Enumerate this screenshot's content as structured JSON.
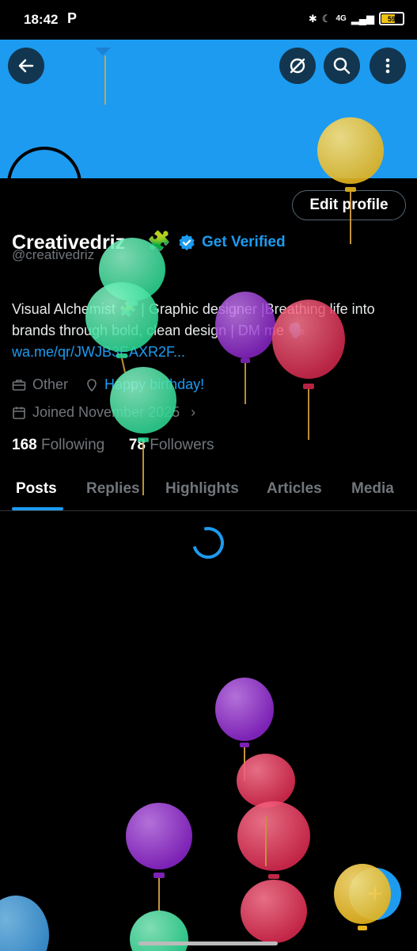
{
  "status_bar": {
    "time": "18:42",
    "app_letter": "P",
    "network": "4G",
    "battery_level": "59"
  },
  "header": {
    "back_icon": "arrow-left-icon",
    "hide_icon": "eye-slash-icon",
    "search_icon": "search-icon",
    "more_icon": "more-vertical-icon"
  },
  "profile": {
    "edit_label": "Edit profile",
    "name": "Creativedriz",
    "name_emoji": "🧩",
    "verified_label": "Get Verified",
    "handle": "@creativedriz",
    "bio": "Visual Alchemist 🧩 | Graphic designer |Breathing life into brands through bold, clean design | DM me 🗣️",
    "bio_link": "wa.me/qr/JWJB3EAXR2F...",
    "category": "Other",
    "location_text": "Happy birthday!",
    "joined": "Joined November 2025",
    "following_count": "168",
    "following_label": "Following",
    "followers_count": "78",
    "followers_label": "Followers"
  },
  "tabs": [
    "Posts",
    "Replies",
    "Highlights",
    "Articles",
    "Media"
  ],
  "active_tab": "Posts",
  "fab_label": "+",
  "colors": {
    "accent": "#1d9bf0",
    "background": "#000000",
    "muted_text": "#71767b",
    "balloon_green": "#3ee6a0",
    "balloon_purple": "#9b30d9",
    "balloon_red": "#e8365b",
    "balloon_yellow": "#f0c52a"
  }
}
